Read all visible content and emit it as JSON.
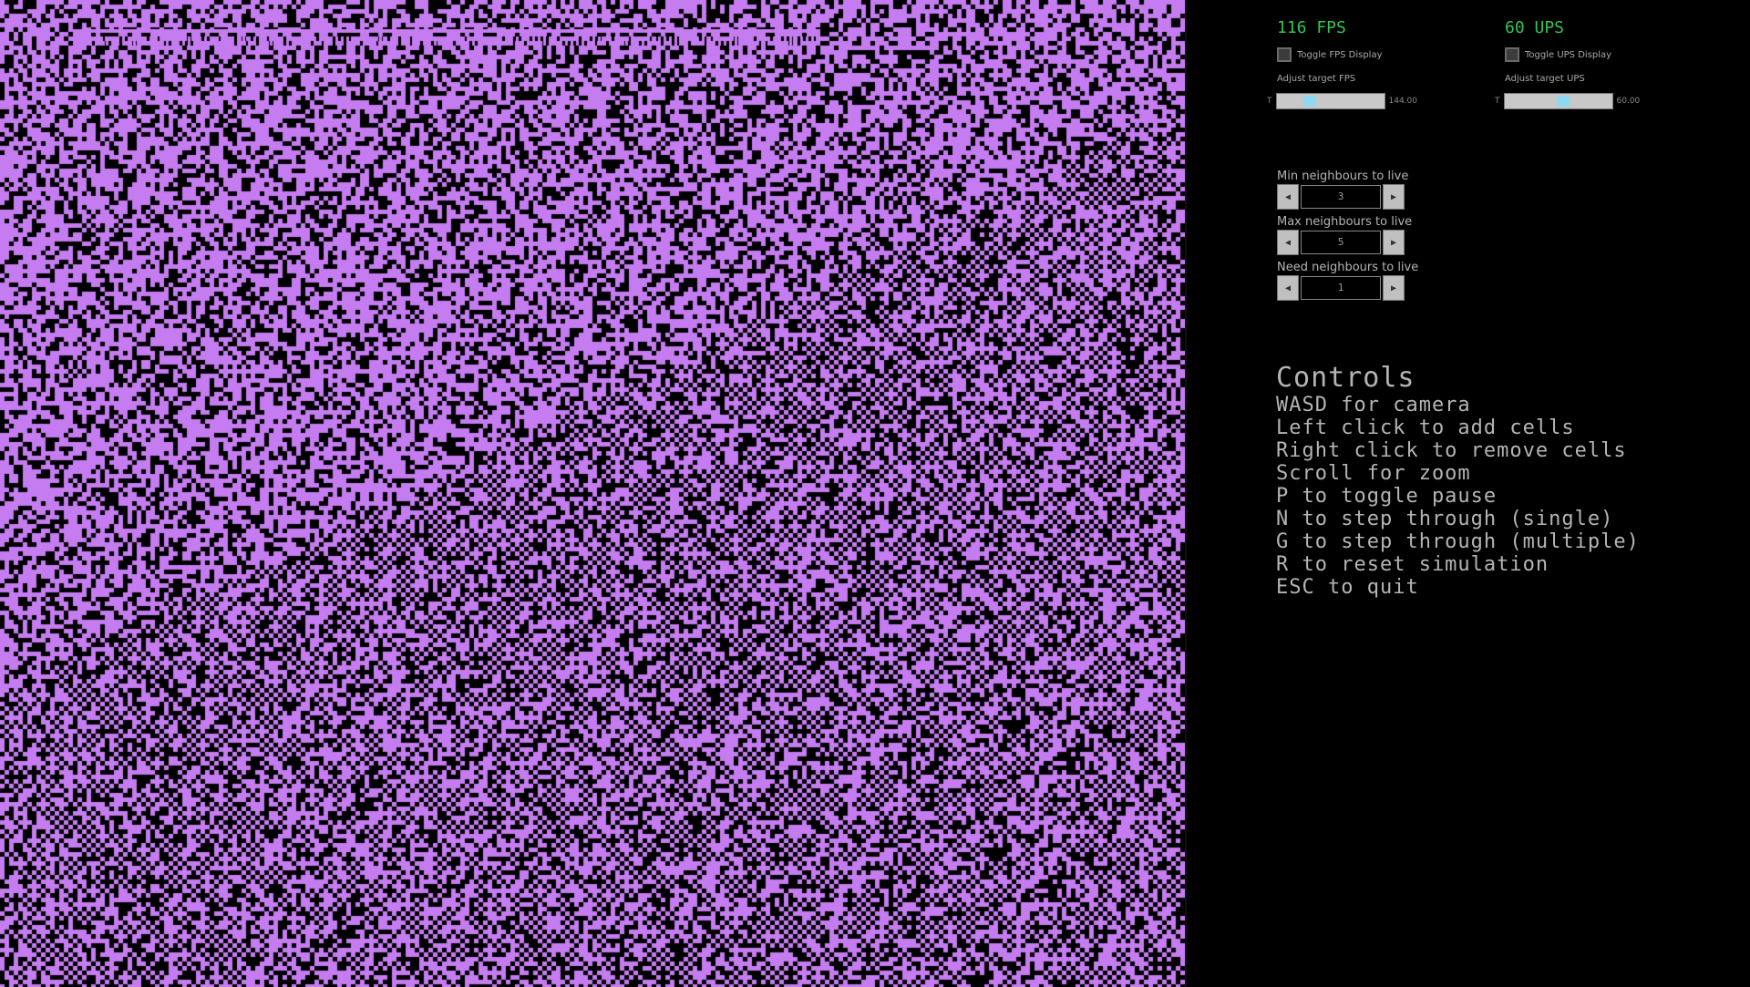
{
  "colors": {
    "cell": "#c57cf0",
    "dead": "#000000",
    "stat_green": "#33c552",
    "panel_text": "#b4b4b4",
    "slider_thumb": "#8fd8f2"
  },
  "fps": {
    "label": "116 FPS",
    "toggle_label": "Toggle FPS Display",
    "adjust_label": "Adjust target FPS",
    "slider_min_glyph": "T",
    "slider_value_text": "144.00",
    "slider_fraction": 0.28
  },
  "ups": {
    "label": "60 UPS",
    "toggle_label": "Toggle UPS Display",
    "adjust_label": "Adjust target UPS",
    "slider_min_glyph": "T",
    "slider_value_text": "60.00",
    "slider_fraction": 0.55
  },
  "rules": [
    {
      "label": "Min neighbours to live",
      "value": "3"
    },
    {
      "label": "Max neighbours to live",
      "value": "5"
    },
    {
      "label": "Need neighbours to live",
      "value": "1"
    }
  ],
  "controls": {
    "title": "Controls",
    "lines": [
      "WASD for camera",
      "Left click to add cells",
      "Right click to remove cells",
      "Scroll for zoom",
      "P to toggle pause",
      "N to step through (single)",
      "G to step through (multiple)",
      "R to reset simulation",
      "ESC to quit"
    ]
  },
  "icons": {
    "spinner_left": "triangle-left-icon",
    "spinner_right": "triangle-right-icon"
  }
}
